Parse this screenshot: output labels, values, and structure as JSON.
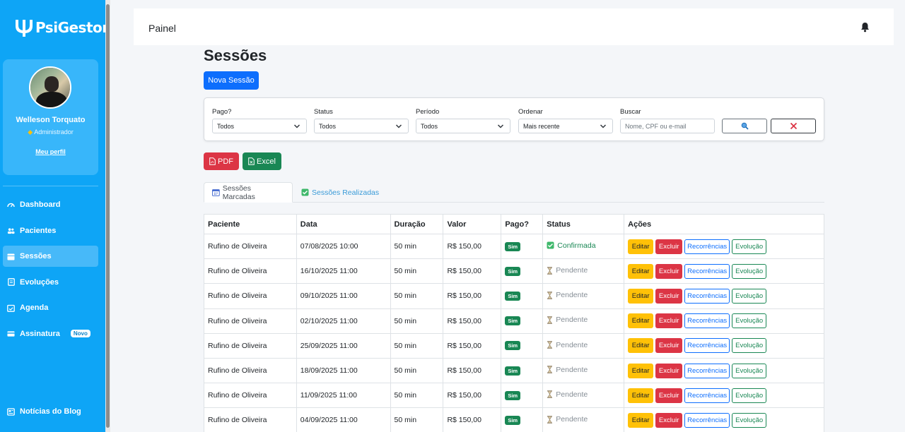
{
  "brand": {
    "name": "PsiGestor"
  },
  "profile": {
    "name": "Welleson Torquato",
    "role": "Administrador",
    "link": "Meu perfil"
  },
  "sidebar": {
    "items": [
      {
        "label": "Dashboard",
        "icon": "gauge-icon",
        "active": false
      },
      {
        "label": "Pacientes",
        "icon": "users-icon",
        "active": false
      },
      {
        "label": "Sessões",
        "icon": "calendar-icon",
        "active": true
      },
      {
        "label": "Evoluções",
        "icon": "document-icon",
        "active": false
      },
      {
        "label": "Agenda",
        "icon": "calendar-check-icon",
        "active": false
      },
      {
        "label": "Assinatura",
        "icon": "credit-card-icon",
        "active": false,
        "badge": "Novo"
      }
    ],
    "blog": {
      "label": "Notícias do Blog",
      "icon": "newspaper-icon"
    }
  },
  "topbar": {
    "title": "Painel",
    "icon": "bell-icon"
  },
  "page": {
    "title": "Sessões",
    "new_button": "Nova Sessão"
  },
  "filters": {
    "pago": {
      "label": "Pago?",
      "value": "Todos"
    },
    "status": {
      "label": "Status",
      "value": "Todos"
    },
    "periodo": {
      "label": "Período",
      "value": "Todos"
    },
    "ordenar": {
      "label": "Ordenar",
      "value": "Mais recente"
    },
    "buscar": {
      "label": "Buscar",
      "placeholder": "Nome, CPF ou e-mail"
    }
  },
  "export": {
    "pdf": "PDF",
    "excel": "Excel"
  },
  "tabs": [
    {
      "label": "Sessões Marcadas",
      "active": true
    },
    {
      "label": "Sessões Realizadas",
      "active": false
    }
  ],
  "table": {
    "headers": [
      "Paciente",
      "Data",
      "Duração",
      "Valor",
      "Pago?",
      "Status",
      "Ações"
    ],
    "actions": {
      "edit": "Editar",
      "delete": "Excluir",
      "recurrence": "Recorrências",
      "evolution": "Evolução"
    },
    "rows": [
      {
        "paciente": "Rufino de Oliveira",
        "data": "07/08/2025 10:00",
        "duracao": "50 min",
        "valor": "R$ 150,00",
        "pago": "Sim",
        "status": "Confirmada"
      },
      {
        "paciente": "Rufino de Oliveira",
        "data": "16/10/2025 11:00",
        "duracao": "50 min",
        "valor": "R$ 150,00",
        "pago": "Sim",
        "status": "Pendente"
      },
      {
        "paciente": "Rufino de Oliveira",
        "data": "09/10/2025 11:00",
        "duracao": "50 min",
        "valor": "R$ 150,00",
        "pago": "Sim",
        "status": "Pendente"
      },
      {
        "paciente": "Rufino de Oliveira",
        "data": "02/10/2025 11:00",
        "duracao": "50 min",
        "valor": "R$ 150,00",
        "pago": "Sim",
        "status": "Pendente"
      },
      {
        "paciente": "Rufino de Oliveira",
        "data": "25/09/2025 11:00",
        "duracao": "50 min",
        "valor": "R$ 150,00",
        "pago": "Sim",
        "status": "Pendente"
      },
      {
        "paciente": "Rufino de Oliveira",
        "data": "18/09/2025 11:00",
        "duracao": "50 min",
        "valor": "R$ 150,00",
        "pago": "Sim",
        "status": "Pendente"
      },
      {
        "paciente": "Rufino de Oliveira",
        "data": "11/09/2025 11:00",
        "duracao": "50 min",
        "valor": "R$ 150,00",
        "pago": "Sim",
        "status": "Pendente"
      },
      {
        "paciente": "Rufino de Oliveira",
        "data": "04/09/2025 11:00",
        "duracao": "50 min",
        "valor": "R$ 150,00",
        "pago": "Sim",
        "status": "Pendente"
      }
    ]
  }
}
